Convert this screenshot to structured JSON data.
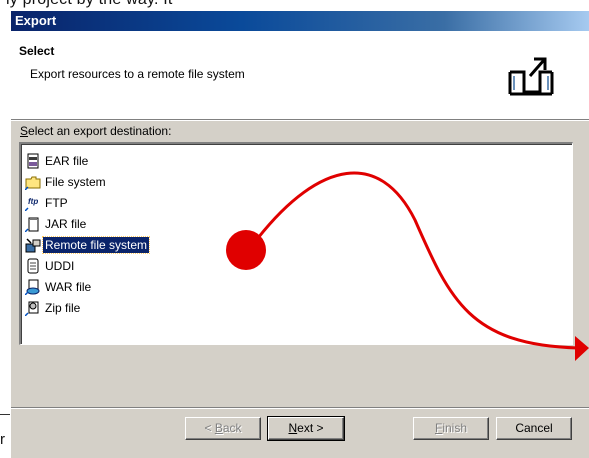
{
  "background": {
    "top_text": "ly project by the way. It",
    "left_text": "r"
  },
  "dialog": {
    "title": "Export",
    "header": {
      "title": "Select",
      "description": "Export resources to a remote file system"
    },
    "destination_label_prefix": "S",
    "destination_label_rest": "elect an export destination:",
    "items": [
      {
        "label": "EAR file",
        "icon": "ear-file-icon"
      },
      {
        "label": "File system",
        "icon": "folder-icon"
      },
      {
        "label": "FTP",
        "icon": "ftp-icon"
      },
      {
        "label": "JAR file",
        "icon": "jar-file-icon"
      },
      {
        "label": "Remote file system",
        "icon": "remote-file-system-icon",
        "selected": true
      },
      {
        "label": "UDDI",
        "icon": "uddi-icon"
      },
      {
        "label": "WAR file",
        "icon": "war-file-icon"
      },
      {
        "label": "Zip file",
        "icon": "zip-file-icon"
      }
    ],
    "buttons": {
      "back": {
        "prefix": "< ",
        "mnemonic": "B",
        "rest": "ack",
        "enabled": false
      },
      "next": {
        "mnemonic": "N",
        "rest": "ext >",
        "enabled": true
      },
      "finish": {
        "mnemonic": "F",
        "rest": "inish",
        "enabled": false
      },
      "cancel": {
        "label": "Cancel",
        "enabled": true
      }
    }
  },
  "colors": {
    "title_bar_start": "#0a246a",
    "title_bar_end": "#a6caf0",
    "selection": "#0a246a",
    "annotation": "#e00000"
  }
}
